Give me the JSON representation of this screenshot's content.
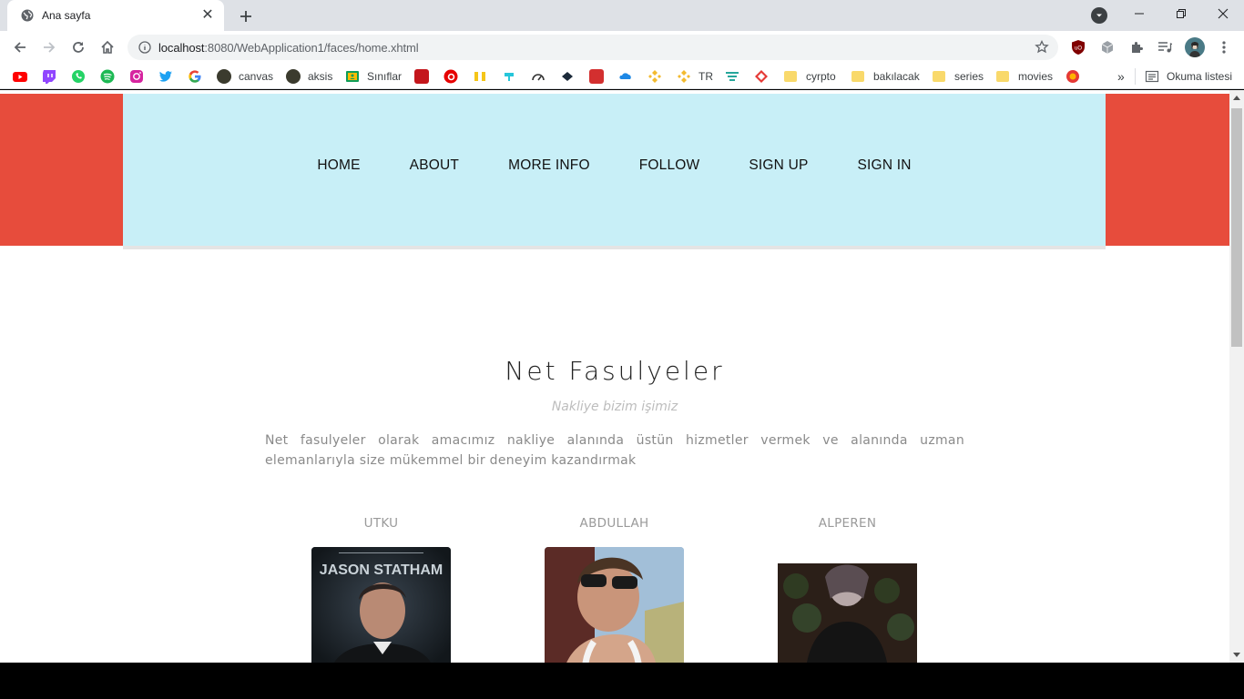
{
  "browser": {
    "tab_title": "Ana sayfa",
    "tab_close": "✕",
    "new_tab": "+",
    "url_host": "localhost",
    "url_rest": ":8080/WebApplication1/faces/home.xhtml",
    "window_minimize": "—",
    "window_restore": "❐",
    "window_close": "✕",
    "bookmarks": {
      "canvas": "canvas",
      "aksis": "aksis",
      "siniflar": "Sınıflar",
      "tr": "TR",
      "cyrpto": "cyrpto",
      "bakilacak": "bakılacak",
      "series": "series",
      "movies": "movies",
      "more": "»",
      "reading_list": "Okuma listesi"
    }
  },
  "nav": {
    "items": [
      "HOME",
      "ABOUT",
      "MORE INFO",
      "FOLLOW",
      "SIGN UP",
      "SIGN IN"
    ]
  },
  "hero": {
    "title": "Net Fasulyeler",
    "subtitle": "Nakliye bizim işimiz",
    "description": "Net fasulyeler olarak amacımız nakliye alanında üstün hizmetler vermek ve alanında uzman elemanlarıyla size mükemmel bir deneyim kazandırmak"
  },
  "team": [
    {
      "name": "UTKU",
      "photo_text": "JASON STATHAM"
    },
    {
      "name": "ABDULLAH"
    },
    {
      "name": "ALPEREN"
    }
  ],
  "colors": {
    "header_red": "#e74c3c",
    "nav_bg": "#c8eff7"
  }
}
